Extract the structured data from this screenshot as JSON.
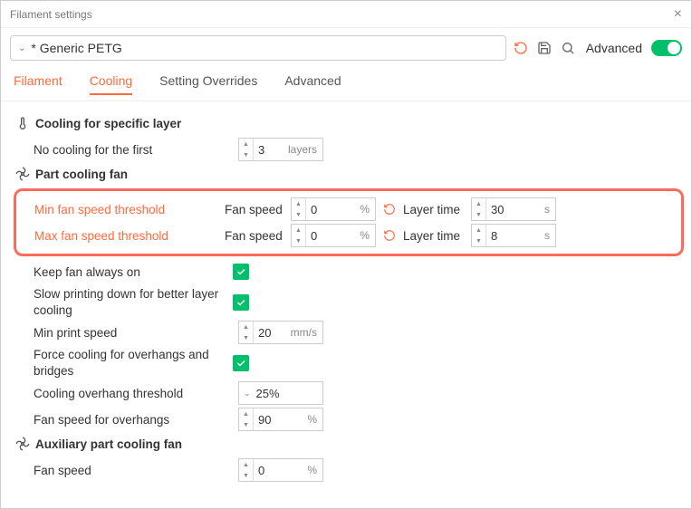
{
  "window": {
    "title": "Filament settings"
  },
  "toolbar": {
    "preset": "* Generic PETG",
    "advanced_label": "Advanced"
  },
  "tabs": {
    "filament": "Filament",
    "cooling": "Cooling",
    "overrides": "Setting Overrides",
    "advanced": "Advanced"
  },
  "sections": {
    "specific": {
      "title": "Cooling for specific layer",
      "no_cooling_label": "No cooling for the first",
      "no_cooling_value": "3",
      "no_cooling_unit": "layers"
    },
    "part_fan": {
      "title": "Part cooling fan",
      "min_thresh_label": "Min fan speed threshold",
      "max_thresh_label": "Max fan speed threshold",
      "fan_speed_label": "Fan speed",
      "layer_time_label": "Layer time",
      "pct_unit": "%",
      "sec_unit": "s",
      "min_fan_speed": "0",
      "min_layer_time": "30",
      "max_fan_speed": "0",
      "max_layer_time": "8",
      "keep_on_label": "Keep fan always on",
      "slow_down_label": "Slow printing down for better layer cooling",
      "min_speed_label": "Min print speed",
      "min_speed_value": "20",
      "min_speed_unit": "mm/s",
      "force_cool_label": "Force cooling for overhangs and bridges",
      "overhang_thresh_label": "Cooling overhang threshold",
      "overhang_thresh_value": "25%",
      "overhang_fan_label": "Fan speed for overhangs",
      "overhang_fan_value": "90"
    },
    "aux_fan": {
      "title": "Auxiliary part cooling fan",
      "fan_speed_label": "Fan speed",
      "fan_speed_value": "0"
    }
  }
}
